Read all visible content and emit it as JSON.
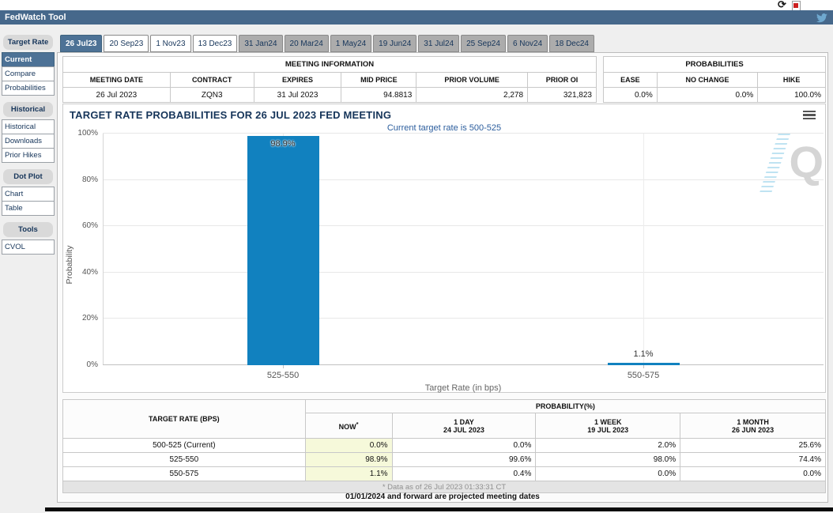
{
  "window": {
    "title": "FedWatch Tool",
    "refresh_icon": "refresh",
    "pdf_icon": "pdf-export",
    "twitter_icon": "twitter-bird"
  },
  "colors": {
    "header_bar": "#46688b",
    "selected_blue": "#4d7296",
    "bar_blue": "#1181bf",
    "now_highlight": "#f6f9da",
    "title_navy": "#16355a",
    "subtitle_blue": "#2b5d9d"
  },
  "sidebar": {
    "sections": [
      {
        "header": "Target Rate",
        "items": [
          {
            "label": "Current",
            "state": "selected"
          },
          {
            "label": "Compare"
          },
          {
            "label": "Probabilities"
          }
        ]
      },
      {
        "header": "Historical",
        "items": [
          {
            "label": "Historical"
          },
          {
            "label": "Downloads"
          },
          {
            "label": "Prior Hikes"
          }
        ]
      },
      {
        "header": "Dot Plot",
        "items": [
          {
            "label": "Chart"
          },
          {
            "label": "Table"
          }
        ]
      },
      {
        "header": "Tools",
        "items": [
          {
            "label": "CVOL"
          }
        ]
      }
    ]
  },
  "tabs": [
    {
      "label": "26 Jul23",
      "state": "selected"
    },
    {
      "label": "20 Sep23"
    },
    {
      "label": "1 Nov23"
    },
    {
      "label": "13 Dec23"
    },
    {
      "label": "31 Jan24",
      "state": "dim"
    },
    {
      "label": "20 Mar24",
      "state": "dim"
    },
    {
      "label": "1 May24",
      "state": "dim"
    },
    {
      "label": "19 Jun24",
      "state": "dim"
    },
    {
      "label": "31 Jul24",
      "state": "dim"
    },
    {
      "label": "25 Sep24",
      "state": "dim"
    },
    {
      "label": "6 Nov24",
      "state": "dim"
    },
    {
      "label": "18 Dec24",
      "state": "dim"
    }
  ],
  "meeting_info": {
    "title": "MEETING INFORMATION",
    "headers": [
      "MEETING DATE",
      "CONTRACT",
      "EXPIRES",
      "MID PRICE",
      "PRIOR VOLUME",
      "PRIOR OI"
    ],
    "values": [
      "26 Jul 2023",
      "ZQN3",
      "31 Jul 2023",
      "94.8813",
      "2,278",
      "321,823"
    ]
  },
  "probabilities_summary": {
    "title": "PROBABILITIES",
    "headers": [
      "EASE",
      "NO CHANGE",
      "HIKE"
    ],
    "values": [
      "0.0%",
      "0.0%",
      "100.0%"
    ]
  },
  "chart_data": {
    "type": "bar",
    "title": "TARGET RATE PROBABILITIES FOR 26 JUL 2023 FED MEETING",
    "subtitle": "Current target rate is 500-525",
    "categories": [
      "525-550",
      "550-575"
    ],
    "values": [
      98.9,
      1.1
    ],
    "value_labels": [
      "98.9%",
      "1.1%"
    ],
    "xlabel": "Target Rate (in bps)",
    "ylabel": "Probability",
    "ylim": [
      0,
      100
    ],
    "yticks": [
      "0%",
      "20%",
      "40%",
      "60%",
      "80%",
      "100%"
    ],
    "bar_color": "#1181bf",
    "grid": true,
    "legend": false,
    "watermark": "Q"
  },
  "probability_table": {
    "col1_header": "TARGET RATE (BPS)",
    "group_header": "PROBABILITY(%)",
    "columns": [
      {
        "label": "NOW",
        "sup": "*",
        "date": ""
      },
      {
        "label": "1 DAY",
        "date": "24 JUL 2023"
      },
      {
        "label": "1 WEEK",
        "date": "19 JUL 2023"
      },
      {
        "label": "1 MONTH",
        "date": "26 JUN 2023"
      }
    ],
    "rows": [
      {
        "rate": "500-525 (Current)",
        "now": "0.0%",
        "d1": "0.0%",
        "w1": "2.0%",
        "m1": "25.6%"
      },
      {
        "rate": "525-550",
        "now": "98.9%",
        "d1": "99.6%",
        "w1": "98.0%",
        "m1": "74.4%"
      },
      {
        "rate": "550-575",
        "now": "1.1%",
        "d1": "0.4%",
        "w1": "0.0%",
        "m1": "0.0%"
      }
    ],
    "footnote": "* Data as of 26 Jul 2023 01:33:31 CT"
  },
  "footer_note": "01/01/2024 and forward are projected meeting dates"
}
